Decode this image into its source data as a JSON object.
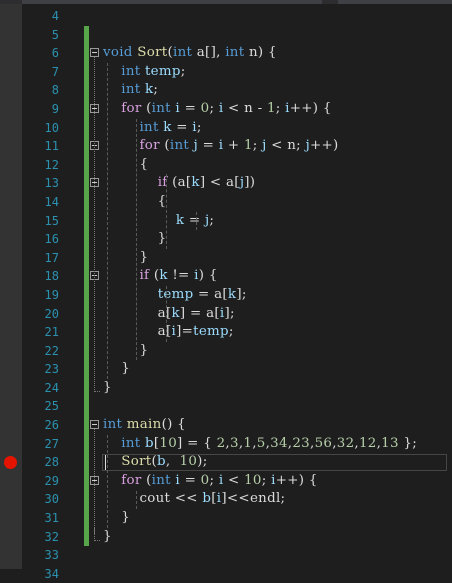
{
  "editor": {
    "lines": [
      {
        "num": "4",
        "tokens": []
      },
      {
        "num": "5",
        "tokens": []
      },
      {
        "num": "6",
        "tokens": [
          [
            "kw",
            "void"
          ],
          [
            "plain",
            " "
          ],
          [
            "fn",
            "Sort"
          ],
          [
            "plain",
            "("
          ],
          [
            "kw",
            "int"
          ],
          [
            "plain",
            " a[], "
          ],
          [
            "kw",
            "int"
          ],
          [
            "plain",
            " n) {"
          ]
        ]
      },
      {
        "num": "7",
        "tokens": [
          [
            "plain",
            "    "
          ],
          [
            "kw",
            "int"
          ],
          [
            "plain",
            " "
          ],
          [
            "var",
            "temp"
          ],
          [
            "plain",
            ";"
          ]
        ]
      },
      {
        "num": "8",
        "tokens": [
          [
            "plain",
            "    "
          ],
          [
            "kw",
            "int"
          ],
          [
            "plain",
            " "
          ],
          [
            "var",
            "k"
          ],
          [
            "plain",
            ";"
          ]
        ]
      },
      {
        "num": "9",
        "tokens": [
          [
            "plain",
            "    "
          ],
          [
            "ctl",
            "for"
          ],
          [
            "plain",
            " ("
          ],
          [
            "kw",
            "int"
          ],
          [
            "plain",
            " "
          ],
          [
            "var",
            "i"
          ],
          [
            "plain",
            " = "
          ],
          [
            "num",
            "0"
          ],
          [
            "plain",
            "; "
          ],
          [
            "var",
            "i"
          ],
          [
            "plain",
            " < n - "
          ],
          [
            "num",
            "1"
          ],
          [
            "plain",
            "; "
          ],
          [
            "var",
            "i"
          ],
          [
            "plain",
            "++) {"
          ]
        ]
      },
      {
        "num": "10",
        "tokens": [
          [
            "plain",
            "        "
          ],
          [
            "kw",
            "int"
          ],
          [
            "plain",
            " "
          ],
          [
            "var",
            "k"
          ],
          [
            "plain",
            " = "
          ],
          [
            "var",
            "i"
          ],
          [
            "plain",
            ";"
          ]
        ]
      },
      {
        "num": "11",
        "tokens": [
          [
            "plain",
            "        "
          ],
          [
            "ctl",
            "for"
          ],
          [
            "plain",
            " ("
          ],
          [
            "kw",
            "int"
          ],
          [
            "plain",
            " "
          ],
          [
            "var",
            "j"
          ],
          [
            "plain",
            " = "
          ],
          [
            "var",
            "i"
          ],
          [
            "plain",
            " + "
          ],
          [
            "num",
            "1"
          ],
          [
            "plain",
            "; "
          ],
          [
            "var",
            "j"
          ],
          [
            "plain",
            " < n; "
          ],
          [
            "var",
            "j"
          ],
          [
            "plain",
            "++)"
          ]
        ]
      },
      {
        "num": "12",
        "tokens": [
          [
            "plain",
            "        {"
          ]
        ]
      },
      {
        "num": "13",
        "tokens": [
          [
            "plain",
            "            "
          ],
          [
            "ctl",
            "if"
          ],
          [
            "plain",
            " (a["
          ],
          [
            "var",
            "k"
          ],
          [
            "plain",
            "] < a["
          ],
          [
            "var",
            "j"
          ],
          [
            "plain",
            "])"
          ]
        ]
      },
      {
        "num": "14",
        "tokens": [
          [
            "plain",
            "            {"
          ]
        ]
      },
      {
        "num": "15",
        "tokens": [
          [
            "plain",
            "                "
          ],
          [
            "var",
            "k"
          ],
          [
            "plain",
            " = "
          ],
          [
            "var",
            "j"
          ],
          [
            "plain",
            ";"
          ]
        ]
      },
      {
        "num": "16",
        "tokens": [
          [
            "plain",
            "            }"
          ]
        ]
      },
      {
        "num": "17",
        "tokens": [
          [
            "plain",
            "        }"
          ]
        ]
      },
      {
        "num": "18",
        "tokens": [
          [
            "plain",
            "        "
          ],
          [
            "ctl",
            "if"
          ],
          [
            "plain",
            " ("
          ],
          [
            "var",
            "k"
          ],
          [
            "plain",
            " != "
          ],
          [
            "var",
            "i"
          ],
          [
            "plain",
            ") {"
          ]
        ]
      },
      {
        "num": "19",
        "tokens": [
          [
            "plain",
            "            "
          ],
          [
            "var",
            "temp"
          ],
          [
            "plain",
            " = a["
          ],
          [
            "var",
            "k"
          ],
          [
            "plain",
            "];"
          ]
        ]
      },
      {
        "num": "20",
        "tokens": [
          [
            "plain",
            "            a["
          ],
          [
            "var",
            "k"
          ],
          [
            "plain",
            "] = a["
          ],
          [
            "var",
            "i"
          ],
          [
            "plain",
            "];"
          ]
        ]
      },
      {
        "num": "21",
        "tokens": [
          [
            "plain",
            "            a["
          ],
          [
            "var",
            "i"
          ],
          [
            "plain",
            "]="
          ],
          [
            "var",
            "temp"
          ],
          [
            "plain",
            ";"
          ]
        ]
      },
      {
        "num": "22",
        "tokens": [
          [
            "plain",
            "        }"
          ]
        ]
      },
      {
        "num": "23",
        "tokens": [
          [
            "plain",
            "    }"
          ]
        ]
      },
      {
        "num": "24",
        "tokens": [
          [
            "plain",
            "}"
          ]
        ]
      },
      {
        "num": "25",
        "tokens": []
      },
      {
        "num": "26",
        "tokens": [
          [
            "kw",
            "int"
          ],
          [
            "plain",
            " "
          ],
          [
            "fn",
            "main"
          ],
          [
            "plain",
            "() {"
          ]
        ]
      },
      {
        "num": "27",
        "tokens": [
          [
            "plain",
            "    "
          ],
          [
            "kw",
            "int"
          ],
          [
            "plain",
            " "
          ],
          [
            "var",
            "b"
          ],
          [
            "plain",
            "["
          ],
          [
            "num",
            "10"
          ],
          [
            "plain",
            "] = { "
          ],
          [
            "num",
            "2"
          ],
          [
            "plain",
            ","
          ],
          [
            "num",
            "3"
          ],
          [
            "plain",
            ","
          ],
          [
            "num",
            "1"
          ],
          [
            "plain",
            ","
          ],
          [
            "num",
            "5"
          ],
          [
            "plain",
            ","
          ],
          [
            "num",
            "34"
          ],
          [
            "plain",
            ","
          ],
          [
            "num",
            "23"
          ],
          [
            "plain",
            ","
          ],
          [
            "num",
            "56"
          ],
          [
            "plain",
            ","
          ],
          [
            "num",
            "32"
          ],
          [
            "plain",
            ","
          ],
          [
            "num",
            "12"
          ],
          [
            "plain",
            ","
          ],
          [
            "num",
            "13"
          ],
          [
            "plain",
            " };"
          ]
        ]
      },
      {
        "num": "28",
        "tokens": [
          [
            "plain",
            "    "
          ],
          [
            "fn",
            "Sort"
          ],
          [
            "plain",
            "("
          ],
          [
            "var",
            "b"
          ],
          [
            "plain",
            ",  "
          ],
          [
            "num",
            "10"
          ],
          [
            "plain",
            ");"
          ]
        ]
      },
      {
        "num": "29",
        "tokens": [
          [
            "plain",
            "    "
          ],
          [
            "ctl",
            "for"
          ],
          [
            "plain",
            " ("
          ],
          [
            "kw",
            "int"
          ],
          [
            "plain",
            " "
          ],
          [
            "var",
            "i"
          ],
          [
            "plain",
            " = "
          ],
          [
            "num",
            "0"
          ],
          [
            "plain",
            "; "
          ],
          [
            "var",
            "i"
          ],
          [
            "plain",
            " < "
          ],
          [
            "num",
            "10"
          ],
          [
            "plain",
            "; "
          ],
          [
            "var",
            "i"
          ],
          [
            "plain",
            "++) {"
          ]
        ]
      },
      {
        "num": "30",
        "tokens": [
          [
            "plain",
            "        cout << "
          ],
          [
            "var",
            "b"
          ],
          [
            "plain",
            "["
          ],
          [
            "var",
            "i"
          ],
          [
            "plain",
            "]<<endl;"
          ]
        ]
      },
      {
        "num": "31",
        "tokens": [
          [
            "plain",
            "    }"
          ]
        ]
      },
      {
        "num": "32",
        "tokens": [
          [
            "plain",
            "}"
          ]
        ]
      },
      {
        "num": "33",
        "tokens": []
      },
      {
        "num": "34",
        "tokens": []
      }
    ],
    "fold_lines": [
      "6",
      "9",
      "11",
      "13",
      "18",
      "26",
      "29"
    ],
    "breakpoint_line": "28",
    "current_line": "28",
    "colors": {
      "keyword": "#569cd6",
      "control": "#d8a0df",
      "variable": "#9cdcfe",
      "function": "#dcdcaa",
      "number": "#b5cea8",
      "line_number": "#2b91af",
      "breakpoint": "#e51400",
      "change_bar": "#57a64a"
    }
  }
}
